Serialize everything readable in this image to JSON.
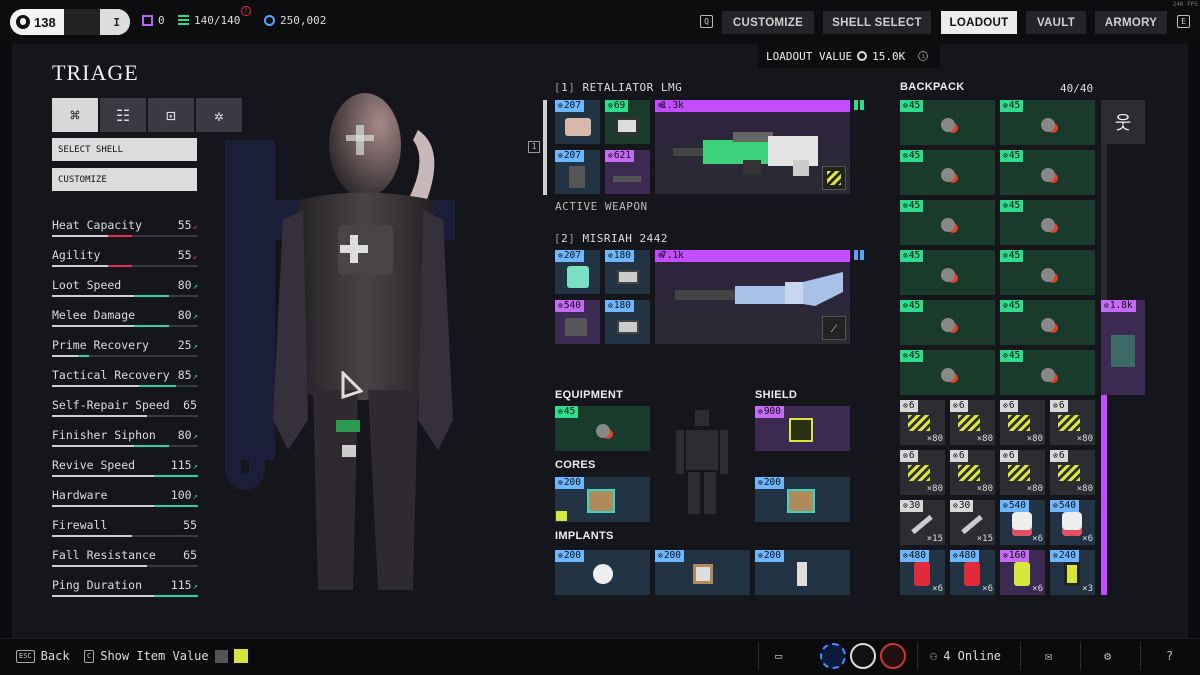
{
  "topbar": {
    "level": "138",
    "tag": "I",
    "marks": "0",
    "capacity": "140/140",
    "credits": "250,002",
    "nav": [
      {
        "key": "Q",
        "label": ""
      },
      {
        "label": "CUSTOMIZE"
      },
      {
        "label": "SHELL SELECT"
      },
      {
        "label": "LOADOUT"
      },
      {
        "label": "VAULT"
      },
      {
        "label": "ARMORY"
      },
      {
        "key": "E",
        "label": ""
      }
    ],
    "key_left": "Q",
    "key_right": "E",
    "active_tab": "LOADOUT"
  },
  "loadout_value": {
    "label": "LOADOUT VALUE",
    "value": "15.0K"
  },
  "shell": {
    "name": "TRIAGE",
    "select_shell": "SELECT SHELL",
    "customize": "CUSTOMIZE"
  },
  "stats": [
    {
      "name": "Heat Capacity",
      "value": "55",
      "trend": "down",
      "fill": 0.55
    },
    {
      "name": "Agility",
      "value": "55",
      "trend": "down",
      "fill": 0.55
    },
    {
      "name": "Loot Speed",
      "value": "80",
      "trend": "up",
      "fill": 0.8
    },
    {
      "name": "Melee Damage",
      "value": "80",
      "trend": "up",
      "fill": 0.8
    },
    {
      "name": "Prime Recovery",
      "value": "25",
      "trend": "up",
      "fill": 0.25
    },
    {
      "name": "Tactical Recovery",
      "value": "85",
      "trend": "up",
      "fill": 0.85
    },
    {
      "name": "Self-Repair Speed",
      "value": "65",
      "trend": "",
      "fill": 0.65
    },
    {
      "name": "Finisher Siphon",
      "value": "80",
      "trend": "up",
      "fill": 0.8
    },
    {
      "name": "Revive Speed",
      "value": "115",
      "trend": "up",
      "fill": 1.0
    },
    {
      "name": "Hardware",
      "value": "100",
      "trend": "up",
      "fill": 1.0
    },
    {
      "name": "Firewall",
      "value": "55",
      "trend": "",
      "fill": 0.55
    },
    {
      "name": "Fall Resistance",
      "value": "65",
      "trend": "",
      "fill": 0.65
    },
    {
      "name": "Ping Duration",
      "value": "115",
      "trend": "up",
      "fill": 1.0
    }
  ],
  "colors": {
    "stat_up": "#2ad49a",
    "stat_down": "#e0304a",
    "stat_neutral": "#bdbdbd",
    "weapon_rarity": "#c44dff",
    "backpack_green": "#2ddc8c"
  },
  "weapon1": {
    "index": "1",
    "name": "RETALIATOR LMG",
    "value": "1.3k",
    "active_label": "ACTIVE WEAPON",
    "mods": [
      "207",
      "69",
      "207",
      "621"
    ]
  },
  "weapon2": {
    "index": "2",
    "name": "MISRIAH 2442",
    "value": "7.1k",
    "mods": [
      "207",
      "180",
      "540",
      "180"
    ]
  },
  "equipment": {
    "label": "EQUIPMENT",
    "value": "45"
  },
  "shield": {
    "label": "SHIELD",
    "value": "900"
  },
  "cores": {
    "label": "CORES",
    "values": [
      "200",
      "200"
    ]
  },
  "implants": {
    "label": "IMPLANTS",
    "values": [
      "200",
      "200",
      "200"
    ]
  },
  "backpack": {
    "label": "BACKPACK",
    "count": "40/40",
    "grenades": [
      "45",
      "45",
      "45",
      "45",
      "45",
      "45",
      "45",
      "45",
      "45",
      "45",
      "45",
      "45"
    ],
    "side_item_value": "1.8k",
    "ammo": [
      {
        "v": "6",
        "q": "×80"
      },
      {
        "v": "6",
        "q": "×80"
      },
      {
        "v": "6",
        "q": "×80"
      },
      {
        "v": "6",
        "q": "×80"
      },
      {
        "v": "6",
        "q": "×80"
      },
      {
        "v": "6",
        "q": "×80"
      },
      {
        "v": "6",
        "q": "×80"
      },
      {
        "v": "6",
        "q": "×80"
      },
      {
        "v": "30",
        "q": "×15"
      },
      {
        "v": "30",
        "q": "×15"
      },
      {
        "v": "540",
        "q": "×6"
      },
      {
        "v": "540",
        "q": "×6"
      },
      {
        "v": "480",
        "q": "×6"
      },
      {
        "v": "480",
        "q": "×6"
      },
      {
        "v": "160",
        "q": "×6"
      },
      {
        "v": "240",
        "q": "×3"
      }
    ]
  },
  "bottom": {
    "back": "Back",
    "back_key": "ESC",
    "show_value": "Show Item Value",
    "show_key": "C",
    "online": "4 Online"
  },
  "fps": "240 FPS"
}
